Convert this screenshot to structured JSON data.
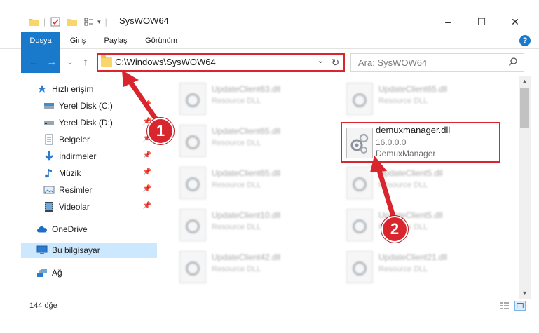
{
  "window": {
    "title": "SysWOW64",
    "minimize": "–",
    "maximize": "☐",
    "close": "✕"
  },
  "ribbon": {
    "tabs": [
      "Dosya",
      "Giriş",
      "Paylaş",
      "Görünüm"
    ],
    "help": "?"
  },
  "nav": {
    "back": "←",
    "forward": "→",
    "recent": "⌄",
    "up": "↑"
  },
  "address": {
    "path": "C:\\Windows\\SysWOW64",
    "dropdown": "⌄",
    "refresh": "↻"
  },
  "search": {
    "placeholder": "Ara: SysWOW64"
  },
  "sidebar": {
    "items": [
      {
        "label": "Hızlı erişim",
        "icon": "star-icon"
      },
      {
        "label": "Yerel Disk (C:)",
        "icon": "drive-icon",
        "pinned": true
      },
      {
        "label": "Yerel Disk (D:)",
        "icon": "drive-icon",
        "pinned": true
      },
      {
        "label": "Belgeler",
        "icon": "documents-icon",
        "pinned": true
      },
      {
        "label": "İndirmeler",
        "icon": "downloads-icon",
        "pinned": true
      },
      {
        "label": "Müzik",
        "icon": "music-icon",
        "pinned": true
      },
      {
        "label": "Resimler",
        "icon": "pictures-icon",
        "pinned": true
      },
      {
        "label": "Videolar",
        "icon": "videos-icon",
        "pinned": true
      },
      {
        "label": "OneDrive",
        "icon": "onedrive-icon"
      },
      {
        "label": "Bu bilgisayar",
        "icon": "computer-icon",
        "selected": true
      },
      {
        "label": "Ağ",
        "icon": "network-icon"
      }
    ]
  },
  "files": [
    {
      "name": "UpdateClient63.dll",
      "desc": "Resource DLL"
    },
    {
      "name": "UpdateClient65.dll",
      "desc": "Resource DLL"
    },
    {
      "name": "UpdateClient65.dll",
      "desc": "Resource DLL"
    },
    {
      "name": "UpdateClient65.dll",
      "desc": "Resource DLL"
    },
    {
      "name": "UpdateClient5.dll",
      "desc": "Resource DLL"
    },
    {
      "name": "UpdateClient10.dll",
      "desc": "Resource DLL"
    },
    {
      "name": "UpdateClient5.dll",
      "desc": "Resource DLL"
    },
    {
      "name": "UpdateClient42.dll",
      "desc": "Resource DLL"
    },
    {
      "name": "UpdateClient21.dll",
      "desc": "Resource DLL"
    }
  ],
  "highlighted_file": {
    "name": "demuxmanager.dll",
    "version": "16.0.0.0",
    "description": "DemuxManager"
  },
  "status": {
    "count": "144 öğe"
  },
  "annotations": {
    "step1": "1",
    "step2": "2",
    "color": "#d9262e"
  }
}
